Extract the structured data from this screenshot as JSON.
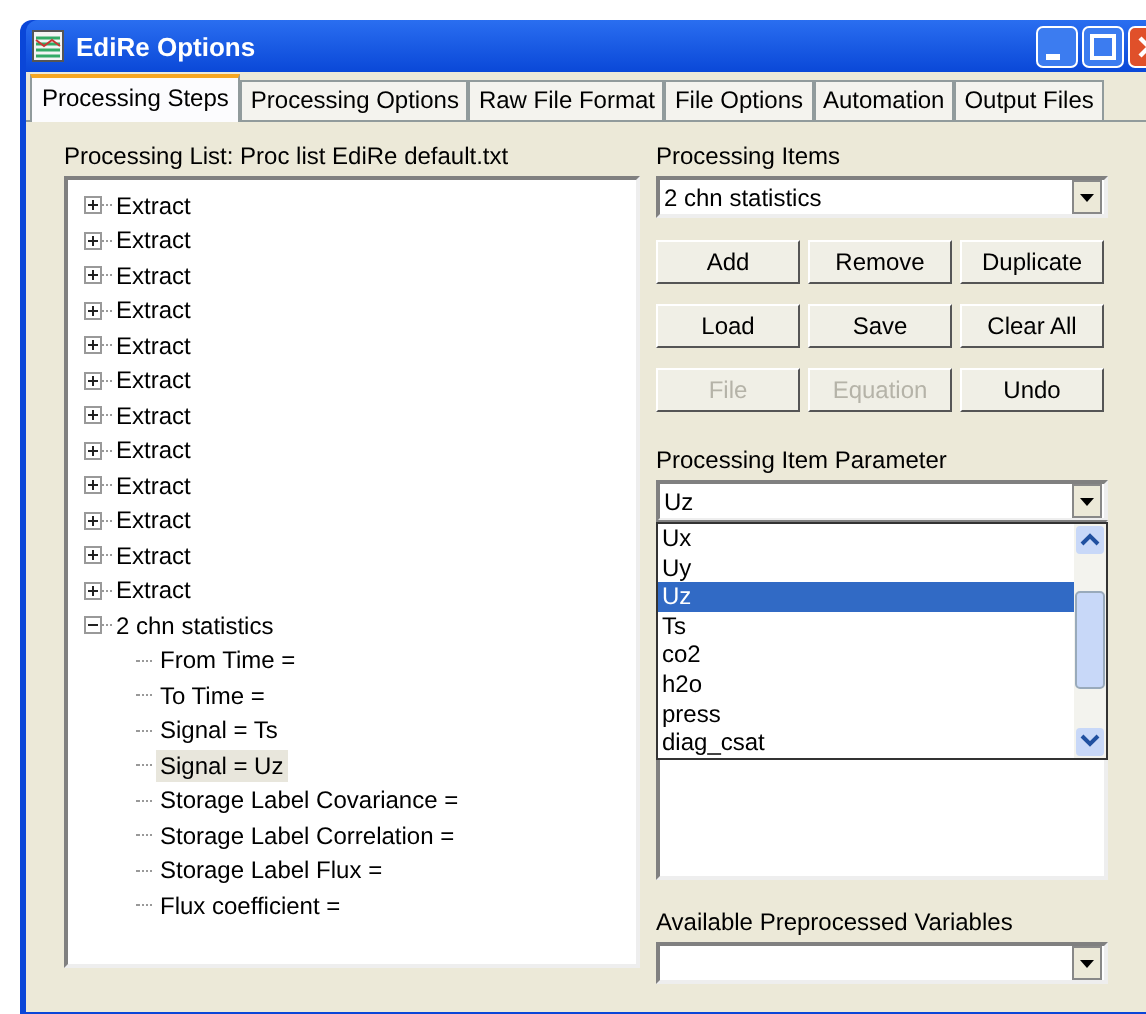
{
  "window": {
    "title": "EdiRe Options"
  },
  "tabs": [
    {
      "label": "Processing Steps",
      "selected": true
    },
    {
      "label": "Processing Options",
      "selected": false
    },
    {
      "label": "Raw File Format",
      "selected": false
    },
    {
      "label": "File Options",
      "selected": false
    },
    {
      "label": "Automation",
      "selected": false
    },
    {
      "label": "Output Files",
      "selected": false
    }
  ],
  "processing_list": {
    "label": "Processing List: Proc list EdiRe default.txt",
    "tree": [
      {
        "label": "Extract",
        "expanded": false
      },
      {
        "label": "Extract",
        "expanded": false
      },
      {
        "label": "Extract",
        "expanded": false
      },
      {
        "label": "Extract",
        "expanded": false
      },
      {
        "label": "Extract",
        "expanded": false
      },
      {
        "label": "Extract",
        "expanded": false
      },
      {
        "label": "Extract",
        "expanded": false
      },
      {
        "label": "Extract",
        "expanded": false
      },
      {
        "label": "Extract",
        "expanded": false
      },
      {
        "label": "Extract",
        "expanded": false
      },
      {
        "label": "Extract",
        "expanded": false
      },
      {
        "label": "Extract",
        "expanded": false
      },
      {
        "label": "2 chn statistics",
        "expanded": true,
        "children": [
          {
            "label": "From Time =",
            "selected": false
          },
          {
            "label": "To Time =",
            "selected": false
          },
          {
            "label": "Signal = Ts",
            "selected": false
          },
          {
            "label": "Signal = Uz",
            "selected": true
          },
          {
            "label": "Storage Label Covariance =",
            "selected": false
          },
          {
            "label": "Storage Label Correlation =",
            "selected": false
          },
          {
            "label": "Storage Label Flux =",
            "selected": false
          },
          {
            "label": "Flux coefficient =",
            "selected": false
          }
        ]
      }
    ]
  },
  "processing_items": {
    "label": "Processing Items",
    "value": "2 chn statistics"
  },
  "buttons": [
    {
      "label": "Add",
      "disabled": false
    },
    {
      "label": "Remove",
      "disabled": false
    },
    {
      "label": "Duplicate",
      "disabled": false
    },
    {
      "label": "Load",
      "disabled": false
    },
    {
      "label": "Save",
      "disabled": false
    },
    {
      "label": "Clear All",
      "disabled": false
    },
    {
      "label": "File",
      "disabled": true
    },
    {
      "label": "Equation",
      "disabled": true
    },
    {
      "label": "Undo",
      "disabled": false
    }
  ],
  "parameter": {
    "label": "Processing Item Parameter",
    "value": "Uz",
    "options": [
      {
        "label": "Ux",
        "selected": false
      },
      {
        "label": "Uy",
        "selected": false
      },
      {
        "label": "Uz",
        "selected": true
      },
      {
        "label": "Ts",
        "selected": false
      },
      {
        "label": "co2",
        "selected": false
      },
      {
        "label": "h2o",
        "selected": false
      },
      {
        "label": "press",
        "selected": false
      },
      {
        "label": "diag_csat",
        "selected": false
      }
    ]
  },
  "available": {
    "label": "Available Preprocessed Variables"
  }
}
